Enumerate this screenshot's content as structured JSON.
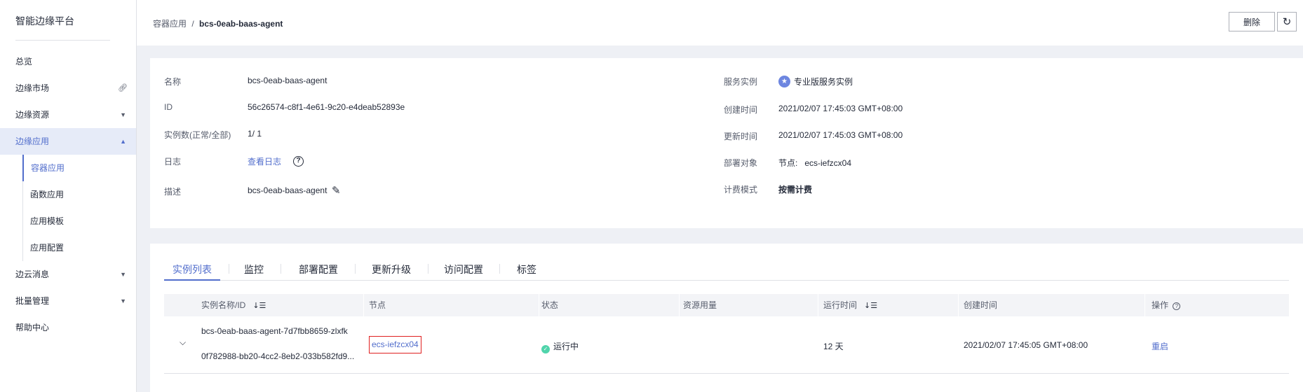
{
  "sidebar": {
    "title": "智能边缘平台",
    "items": [
      {
        "label": "总览"
      },
      {
        "label": "边缘市场"
      },
      {
        "label": "边缘资源"
      },
      {
        "label": "边缘应用"
      },
      {
        "label": "边云消息"
      },
      {
        "label": "批量管理"
      },
      {
        "label": "帮助中心"
      }
    ],
    "sub_items": [
      {
        "label": "容器应用"
      },
      {
        "label": "函数应用"
      },
      {
        "label": "应用模板"
      },
      {
        "label": "应用配置"
      }
    ]
  },
  "breadcrumb": {
    "parent": "容器应用",
    "separator": "/",
    "current": "bcs-0eab-baas-agent"
  },
  "toolbar": {
    "delete_label": "删除",
    "refresh_icon": "refresh-icon"
  },
  "details": {
    "name_label": "名称",
    "name_value": "bcs-0eab-baas-agent",
    "id_label": "ID",
    "id_value": "56c26574-c8f1-4e61-9c20-e4deab52893e",
    "instances_label": "实例数(正常/全部)",
    "instances_value": "1/ 1",
    "log_label": "日志",
    "log_link": "查看日志",
    "desc_label": "描述",
    "desc_value": "bcs-0eab-baas-agent",
    "service_label": "服务实例",
    "service_value": "专业版服务实例",
    "created_label": "创建时间",
    "created_value": "2021/02/07 17:45:03 GMT+08:00",
    "updated_label": "更新时间",
    "updated_value": "2021/02/07 17:45:03 GMT+08:00",
    "target_label": "部署对象",
    "target_value": "节点:   ecs-iefzcx04",
    "billing_label": "计费模式",
    "billing_value": "按需计费"
  },
  "tabs": [
    {
      "label": "实例列表",
      "active": true
    },
    {
      "label": "监控"
    },
    {
      "label": "部署配置"
    },
    {
      "label": "更新升级"
    },
    {
      "label": "访问配置"
    },
    {
      "label": "标签"
    }
  ],
  "table": {
    "columns": [
      "实例名称/ID",
      "节点",
      "状态",
      "资源用量",
      "运行时间",
      "创建时间",
      "操作"
    ],
    "rows": [
      {
        "name": "bcs-0eab-baas-agent-7d7fbb8659-zlxfk",
        "id": "0f782988-bb20-4cc2-8eb2-033b582fd9...",
        "node": "ecs-iefzcx04",
        "status": "运行中",
        "usage": "",
        "uptime": "12 天",
        "created": "2021/02/07 17:45:05 GMT+08:00",
        "action": "重启"
      }
    ]
  },
  "colors": {
    "accent": "#526ecc",
    "status_running": "#50d4ab",
    "highlight_border": "#e02020"
  }
}
